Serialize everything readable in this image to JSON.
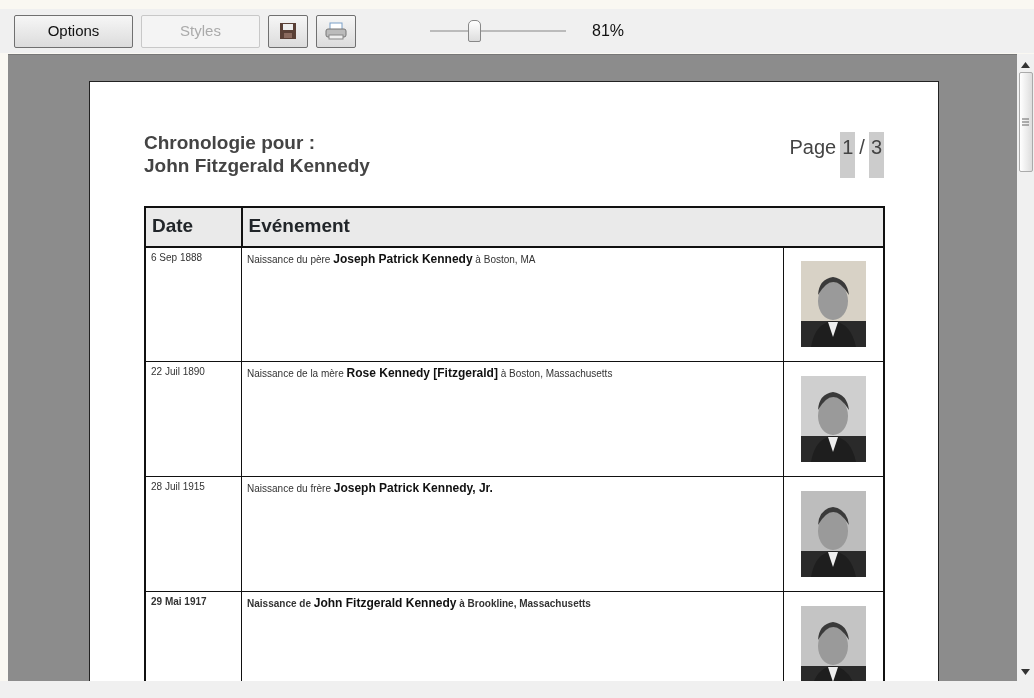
{
  "toolbar": {
    "buttons": [
      {
        "kind": "text",
        "label": "Options",
        "disabled": false
      },
      {
        "kind": "text",
        "label": "Styles",
        "disabled": true
      },
      {
        "kind": "save"
      },
      {
        "kind": "print"
      }
    ],
    "zoom": {
      "level": 0.32,
      "reading": "81%"
    }
  },
  "report": {
    "title_lines": [
      "Chronologie pour :",
      "John Fitzgerald Kennedy"
    ],
    "page": {
      "label": "Page",
      "current": "1",
      "separator": "/",
      "total": "3"
    },
    "columns": [
      "Date",
      "Evénement"
    ],
    "rows": [
      {
        "date": "6 Sep 1888",
        "event": "Naissance du père **Joseph Patrick Kennedy** à Boston, MA",
        "bold": false
      },
      {
        "date": "22 Juil 1890",
        "event": "Naissance de la mère **Rose Kennedy [Fitzgerald]** à Boston, Massachusetts",
        "bold": false
      },
      {
        "date": "28 Juil 1915",
        "event": "Naissance du frère **Joseph Patrick Kennedy, Jr.**",
        "bold": false
      },
      {
        "date": "29 Mai 1917",
        "event": "Naissance de **John Fitzgerald Kennedy** à Brookline, Massachusetts",
        "bold": true
      }
    ]
  }
}
